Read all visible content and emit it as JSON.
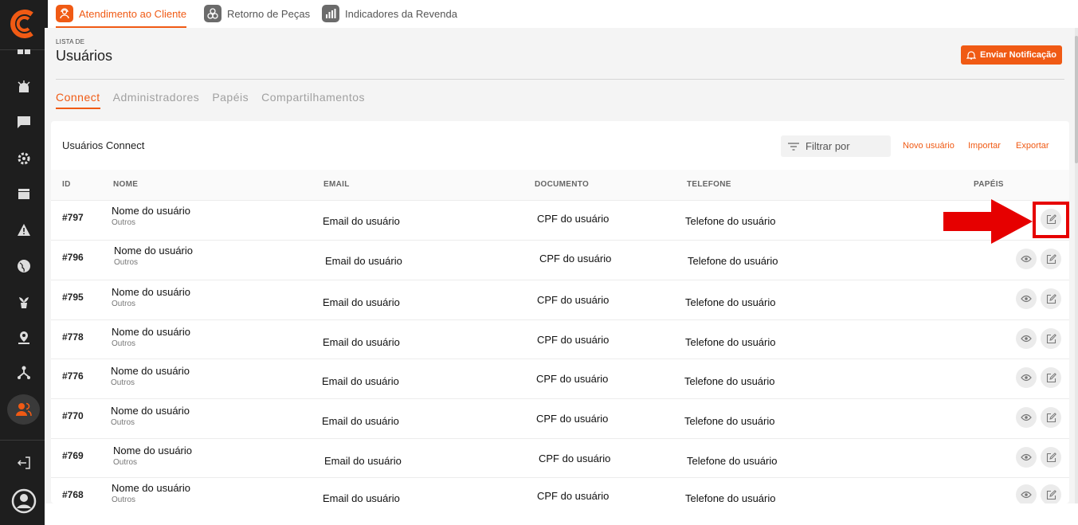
{
  "topnav": [
    {
      "label": "Atendimento ao Cliente",
      "icon": "headset-icon",
      "active": true
    },
    {
      "label": "Retorno de Peças",
      "icon": "gears-icon",
      "active": false
    },
    {
      "label": "Indicadores da Revenda",
      "icon": "bar-chart-icon",
      "active": false
    }
  ],
  "header": {
    "lista_de": "LISTA DE",
    "title": "Usuários",
    "notify_button": "Enviar Notificação"
  },
  "tabs": [
    "Connect",
    "Administradores",
    "Papéis",
    "Compartilhamentos"
  ],
  "active_tab": "Connect",
  "card": {
    "title": "Usuários Connect",
    "filter_placeholder": "Filtrar por",
    "actions": {
      "new_user": "Novo usuário",
      "import": "Importar",
      "export": "Exportar"
    }
  },
  "table": {
    "headers": {
      "id": "ID",
      "name": "NOME",
      "email": "EMAIL",
      "document": "DOCUMENTO",
      "phone": "TELEFONE",
      "roles": "PAPÉIS"
    },
    "rows": [
      {
        "id": "#797",
        "name": "Nome do usuário",
        "type": "Outros",
        "email": "Email do usuário",
        "document": "CPF do usuário",
        "phone": "Telefone do usuário"
      },
      {
        "id": "#796",
        "name": "Nome do usuário",
        "type": "Outros",
        "email": "Email do usuário",
        "document": "CPF do usuário",
        "phone": "Telefone do usuário"
      },
      {
        "id": "#795",
        "name": "Nome do usuário",
        "type": "Outros",
        "email": "Email do usuário",
        "document": "CPF do usuário",
        "phone": "Telefone do usuário"
      },
      {
        "id": "#778",
        "name": "Nome do usuário",
        "type": "Outros",
        "email": "Email do usuário",
        "document": "CPF do usuário",
        "phone": "Telefone do usuário"
      },
      {
        "id": "#776",
        "name": "Nome do usuário",
        "type": "Outros",
        "email": "Email do usuário",
        "document": "CPF do usuário",
        "phone": "Telefone do usuário"
      },
      {
        "id": "#770",
        "name": "Nome do usuário",
        "type": "Outros",
        "email": "Email do usuário",
        "document": "CPF do usuário",
        "phone": "Telefone do usuário"
      },
      {
        "id": "#769",
        "name": "Nome do usuário",
        "type": "Outros",
        "email": "Email do usuário",
        "document": "CPF do usuário",
        "phone": "Telefone do usuário"
      },
      {
        "id": "#768",
        "name": "Nome do usuário",
        "type": "Outros",
        "email": "Email do usuário",
        "document": "CPF do usuário",
        "phone": "Telefone do usuário"
      }
    ]
  },
  "sidebar_icons": [
    "dashboard-icon",
    "alarm-icon",
    "chat-icon",
    "settings-icon",
    "calendar-icon",
    "warning-icon",
    "globe-icon",
    "plant-icon",
    "location-icon",
    "hierarchy-icon",
    "users-icon",
    "logout-icon",
    "user-avatar-icon"
  ],
  "colors": {
    "accent": "#f05a14",
    "sidebar": "#1e1e1e",
    "highlight": "#e60000"
  }
}
